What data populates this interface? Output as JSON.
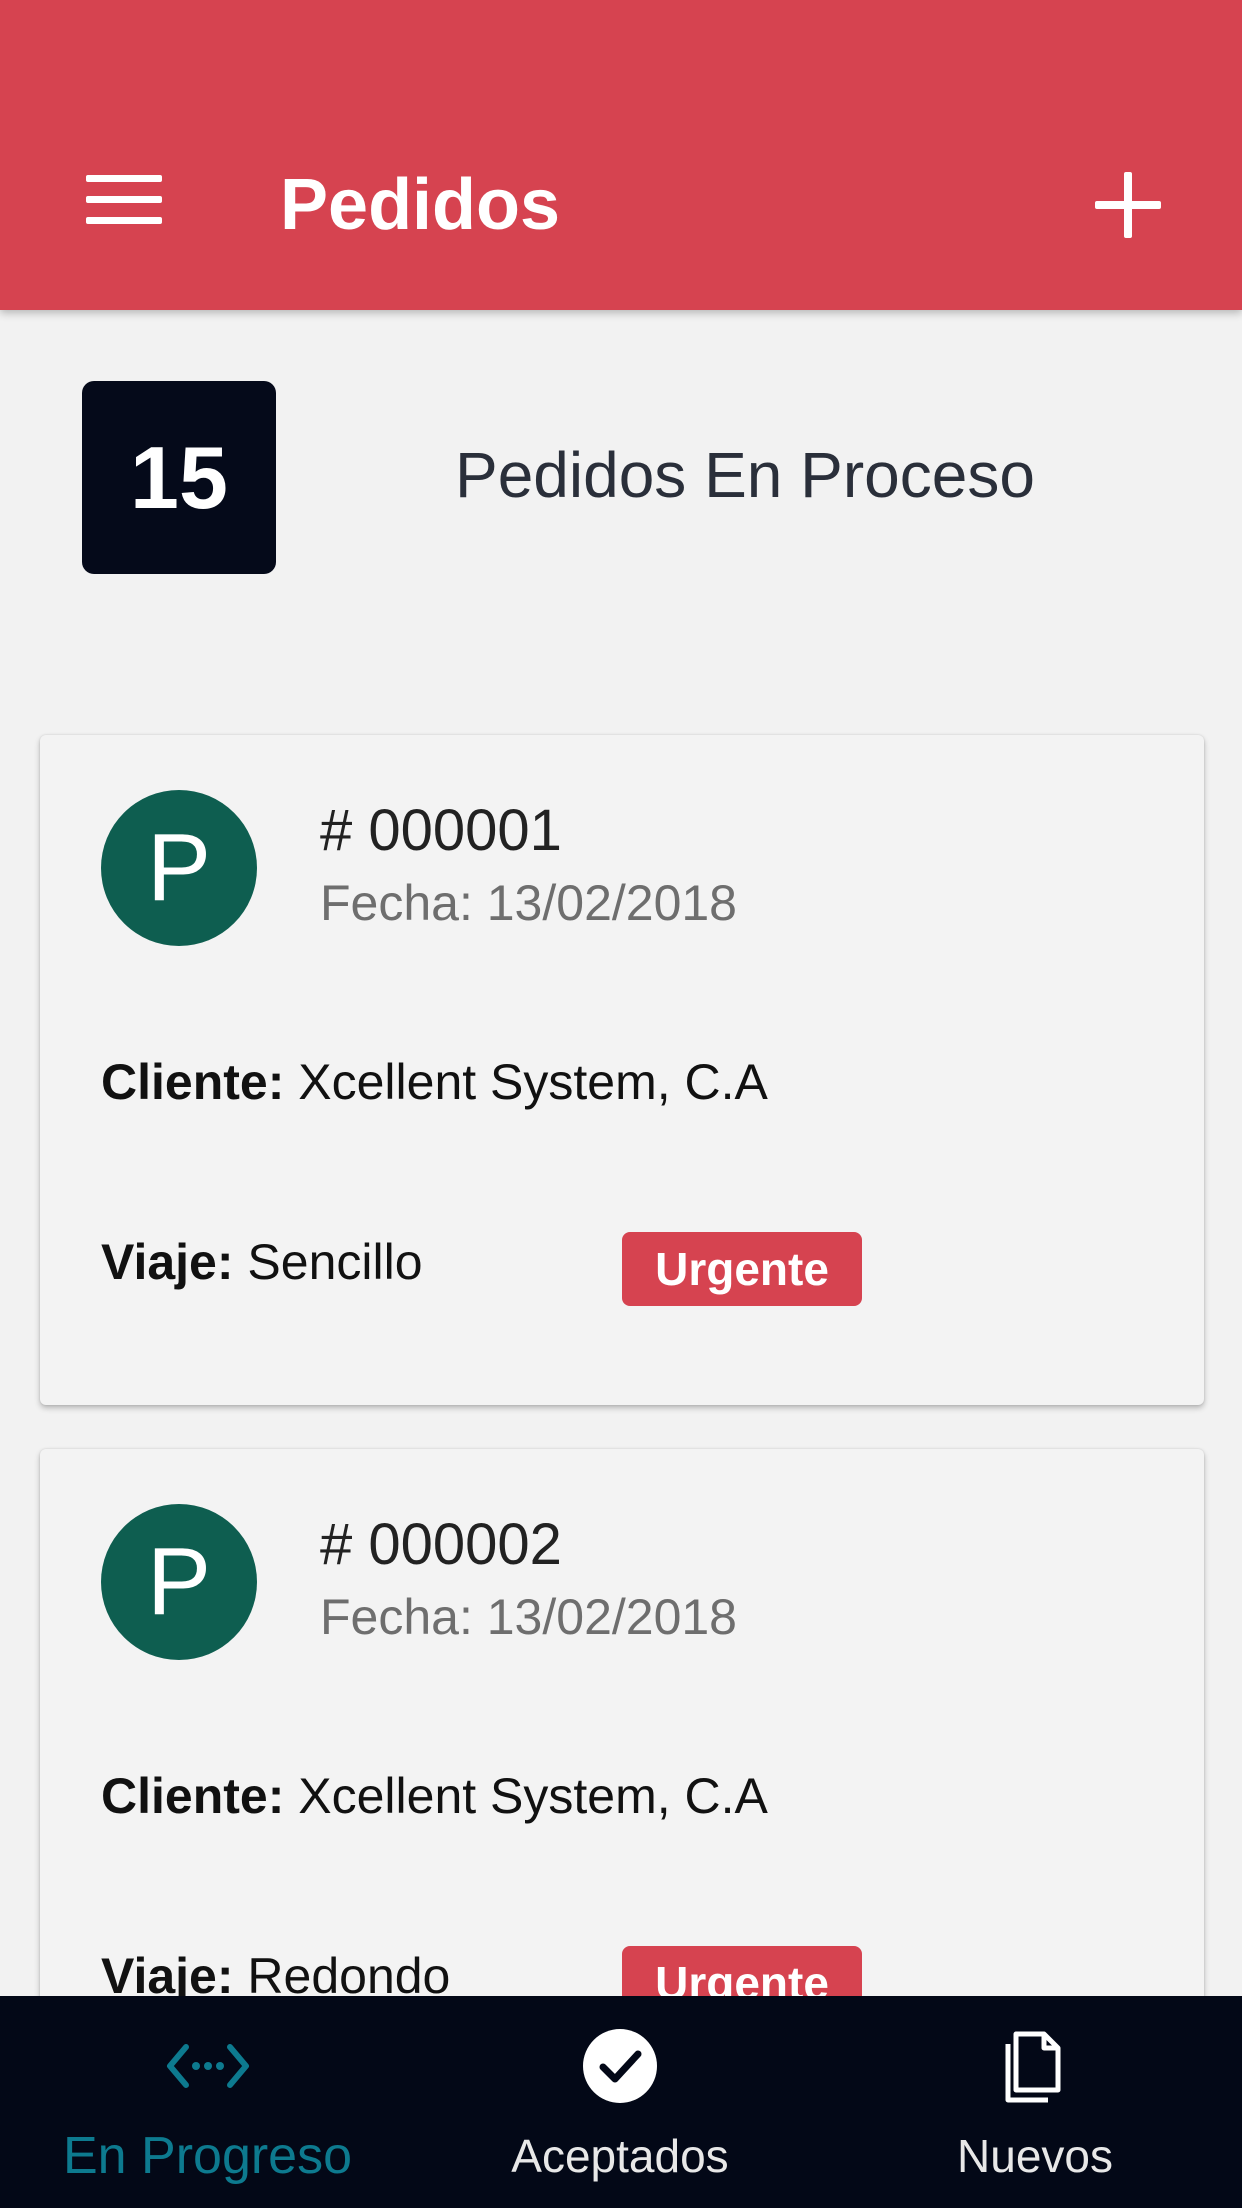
{
  "header": {
    "title": "Pedidos",
    "menu_icon": "hamburger-menu-icon",
    "add_icon": "plus-icon",
    "color": "#d64350"
  },
  "summary": {
    "count": "15",
    "label": "Pedidos En Proceso"
  },
  "orders": [
    {
      "avatar_letter": "P",
      "number": "# 000001",
      "date": "Fecha: 13/02/2018",
      "client_label": "Cliente:",
      "client_value": "Xcellent System, C.A",
      "trip_label": "Viaje:",
      "trip_value": "Sencillo",
      "badge": "Urgente"
    },
    {
      "avatar_letter": "P",
      "number": "# 000002",
      "date": "Fecha: 13/02/2018",
      "client_label": "Cliente:",
      "client_value": "Xcellent System, C.A",
      "trip_label": "Viaje:",
      "trip_value": "Redondo",
      "badge": "Urgente"
    }
  ],
  "bottom_nav": {
    "items": [
      {
        "label": "En Progreso",
        "icon": "code-arrows-icon",
        "active": true
      },
      {
        "label": "Aceptados",
        "icon": "check-circle-icon",
        "active": false
      },
      {
        "label": "Nuevos",
        "icon": "documents-icon",
        "active": false
      }
    ],
    "active_color": "#0d7a8f"
  },
  "colors": {
    "avatar": "#0e5e50",
    "count_box": "#050a1a",
    "background": "#f2f2f2"
  }
}
